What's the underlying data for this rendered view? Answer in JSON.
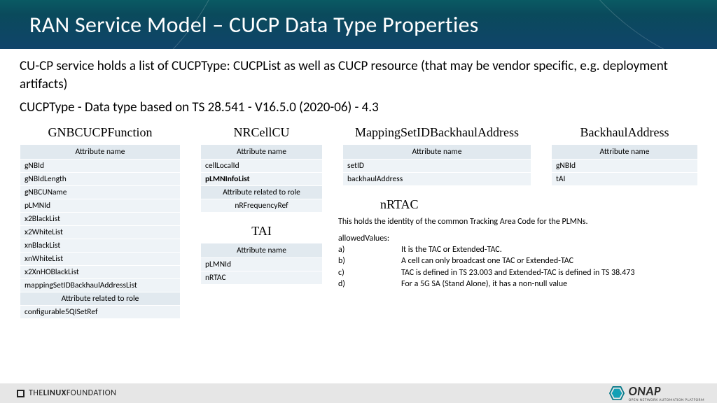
{
  "title": "RAN Service Model – CUCP Data Type Properties",
  "intro_line1": "CU-CP service holds a list of CUCPType: CUCPList as well as CUCP resource (that may be vendor specific, e.g. deployment artifacts)",
  "intro_line2": "CUCPType - Data type based on TS 28.541 - V16.5.0 (2020-06) - 4.3",
  "headers": {
    "attr_name": "Attribute name",
    "attr_role": "Attribute related to role"
  },
  "tables": {
    "gnbcucp": {
      "title": "GNBCUCPFunction",
      "rows": [
        "gNBId",
        "gNBIdLength",
        "gNBCUName",
        "pLMNId",
        "x2BlackList",
        "x2WhiteList",
        "xnBlackList",
        "xnWhiteList",
        "x2XnHOBlackList",
        "mappingSetIDBackhaulAddressList"
      ],
      "role_rows": [
        "configurable5QISetRef"
      ]
    },
    "nrcellcu": {
      "title": "NRCellCU",
      "rows": [
        "cellLocalId"
      ],
      "bold_rows": [
        "pLMNInfoList"
      ],
      "role_rows": [
        "nRFrequencyRef"
      ]
    },
    "mapping": {
      "title": "MappingSetIDBackhaulAddress",
      "rows": [
        "setID",
        "backhaulAddress"
      ]
    },
    "backhaul": {
      "title": "BackhaulAddress",
      "rows": [
        "gNBId",
        "tAI"
      ]
    },
    "tai": {
      "title": "TAI",
      "rows": [
        "pLMNId",
        "nRTAC"
      ]
    }
  },
  "nrtac": {
    "title": "nRTAC",
    "desc": "This holds the identity of the common Tracking Area Code for the PLMNs.",
    "allowed_label": "allowedValues:",
    "opts": {
      "a": "It is the TAC or Extended-TAC.",
      "b": "A cell can only broadcast one TAC or Extended-TAC",
      "c": "TAC is defined in TS 23.003 and Extended-TAC is defined in TS 38.473",
      "d": "For a 5G SA (Stand Alone), it has a non-null value"
    }
  },
  "footer": {
    "lf1": "THE",
    "lf2": "LINUX",
    "lf3": "FOUNDATION",
    "onap": "ONAP",
    "onap_sub": "OPEN NETWORK AUTOMATION PLATFORM"
  }
}
